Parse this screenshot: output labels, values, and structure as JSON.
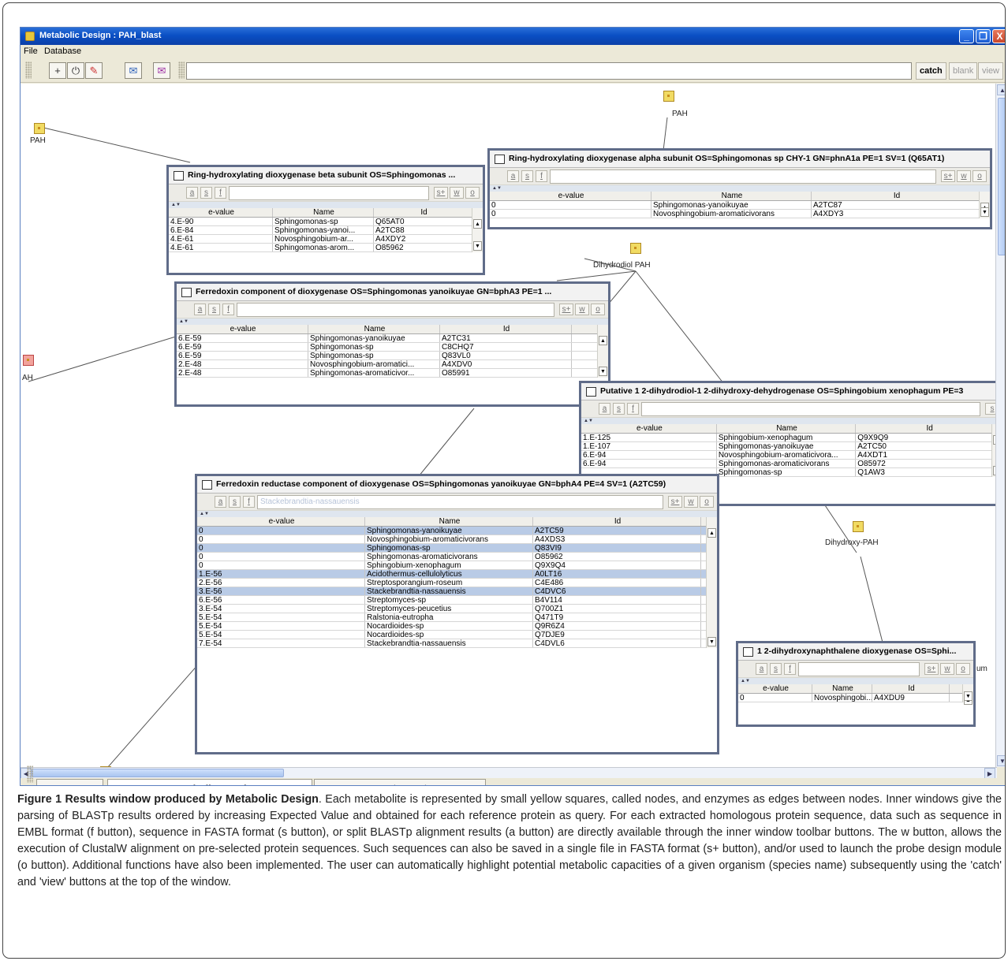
{
  "window": {
    "title": "Metabolic Design  :  PAH_blast",
    "menu": [
      "File",
      "Database"
    ],
    "controls": [
      "_",
      "❐",
      "X"
    ]
  },
  "toolbar": {
    "buttons": [
      "+",
      "⏻",
      "✎",
      "✉",
      "✉"
    ],
    "right": [
      "catch",
      "blank",
      "view"
    ]
  },
  "nodes": [
    {
      "label": "PAH"
    },
    {
      "label": "PAH"
    },
    {
      "label": "AH"
    },
    {
      "label": "Dihydrodiol PAH"
    },
    {
      "label": "Dihydroxy-PAH"
    },
    {
      "label": ""
    }
  ],
  "inner_windows": [
    {
      "title": "Ring-hydroxylating dioxygenase beta subunit OS=Sphingomonas ...",
      "toolbar": [
        "a",
        "s",
        "f"
      ],
      "toolbar_right": [
        "s+",
        "w",
        "o"
      ],
      "search": "",
      "columns": [
        "e-value",
        "Name",
        "Id"
      ],
      "rows": [
        [
          "4.E-90",
          "Sphingomonas-sp",
          "Q65AT0"
        ],
        [
          "6.E-84",
          "Sphingomonas-yanoi...",
          "A2TC88"
        ],
        [
          "4.E-61",
          "Novosphingobium-ar...",
          "A4XDY2"
        ],
        [
          "4.E-61",
          "Sphingomonas-arom...",
          "O85962"
        ]
      ]
    },
    {
      "title": "Ring-hydroxylating dioxygenase alpha subunit OS=Sphingomonas sp CHY-1 GN=phnA1a PE=1 SV=1 (Q65AT1)",
      "toolbar": [
        "a",
        "s",
        "f"
      ],
      "toolbar_right": [
        "s+",
        "w",
        "o"
      ],
      "search": "",
      "columns": [
        "e-value",
        "Name",
        "Id"
      ],
      "rows": [
        [
          "0",
          "Sphingomonas-yanoikuyae",
          "A2TC87"
        ],
        [
          "0",
          "Novosphingobium-aromaticivorans",
          "A4XDY3"
        ]
      ]
    },
    {
      "title": "Ferredoxin component of dioxygenase OS=Sphingomonas yanoikuyae GN=bphA3 PE=1 ...",
      "toolbar": [
        "a",
        "s",
        "f"
      ],
      "toolbar_right": [
        "s+",
        "w",
        "o"
      ],
      "search": "",
      "columns": [
        "e-value",
        "Name",
        "Id"
      ],
      "rows": [
        [
          "6.E-59",
          "Sphingomonas-yanoikuyae",
          "A2TC31"
        ],
        [
          "6.E-59",
          "Sphingomonas-sp",
          "C8CHQ7"
        ],
        [
          "6.E-59",
          "Sphingomonas-sp",
          "Q83VL0"
        ],
        [
          "2.E-48",
          "Novosphingobium-aromatici...",
          "A4XDV0"
        ],
        [
          "2.E-48",
          "Sphingomonas-aromaticivor...",
          "O85991"
        ]
      ]
    },
    {
      "title": "Putative 1 2-dihydrodiol-1 2-dihydroxy-dehydrogenase OS=Sphingobium xenophagum PE=3",
      "toolbar": [
        "a",
        "s",
        "f"
      ],
      "toolbar_right": [
        "s"
      ],
      "search": "",
      "columns": [
        "e-value",
        "Name",
        "Id"
      ],
      "rows": [
        [
          "1.E-125",
          "Sphingobium-xenophagum",
          "Q9X9Q9"
        ],
        [
          "1.E-107",
          "Sphingomonas-yanoikuyae",
          "A2TC50"
        ],
        [
          "6.E-94",
          "Novosphingobium-aromaticivora...",
          "A4XDT1"
        ],
        [
          "6.E-94",
          "Sphingomonas-aromaticivorans",
          "O85972"
        ],
        [
          "",
          "Sphingomonas-sp",
          "Q1AW3"
        ]
      ]
    },
    {
      "title": "Ferredoxin reductase component of dioxygenase OS=Sphingomonas yanoikuyae GN=bphA4 PE=4 SV=1 (A2TC59)",
      "toolbar": [
        "a",
        "s",
        "f"
      ],
      "toolbar_right": [
        "s+",
        "w",
        "o"
      ],
      "search": "Stackebrandtia-nassauensis",
      "columns": [
        "e-value",
        "Name",
        "Id"
      ],
      "rows": [
        [
          "0",
          "Sphingomonas-yanoikuyae",
          "A2TC59"
        ],
        [
          "0",
          "Novosphingobium-aromaticivorans",
          "A4XDS3"
        ],
        [
          "0",
          "Sphingomonas-sp",
          "Q83VI9"
        ],
        [
          "0",
          "Sphingomonas-aromaticivorans",
          "O85962"
        ],
        [
          "0",
          "Sphingobium-xenophagum",
          "Q9X9Q4"
        ],
        [
          "1.E-56",
          "Acidothermus-cellulolyticus",
          "A0LT16"
        ],
        [
          "2.E-56",
          "Streptosporangium-roseum",
          "C4E486"
        ],
        [
          "3.E-56",
          "Stackebrandtia-nassauensis",
          "C4DVC6"
        ],
        [
          "6.E-56",
          "Streptomyces-sp",
          "B4V114"
        ],
        [
          "3.E-54",
          "Streptomyces-peucetius",
          "Q700Z1"
        ],
        [
          "5.E-54",
          "Ralstonia-eutropha",
          "Q471T9"
        ],
        [
          "5.E-54",
          "Nocardioides-sp",
          "Q9R6Z4"
        ],
        [
          "5.E-54",
          "Nocardioides-sp",
          "Q7DJE9"
        ],
        [
          "7.E-54",
          "Stackebrandtia-nassauensis",
          "C4DVL6"
        ]
      ],
      "selected": [
        0,
        2,
        5,
        7
      ]
    },
    {
      "title": "1 2-dihydroxynaphthalene dioxygenase OS=Sphi...",
      "toolbar": [
        "a",
        "s",
        "f"
      ],
      "toolbar_right": [
        "s+",
        "w",
        "o"
      ],
      "search": "",
      "columns": [
        "e-value",
        "Name",
        "Id"
      ],
      "rows": [
        [
          "0",
          "Novosphingobi...",
          "A4XDU9"
        ]
      ]
    }
  ],
  "side_text": "um",
  "tabs": [
    "- BLAST -",
    "- Metabolic Graph -",
    "- Result Graph -"
  ],
  "caption": {
    "lead": "Figure 1 Results window produced by Metabolic Design",
    "body": ". Each metabolite is represented by small yellow squares, called nodes, and enzymes as edges between nodes. Inner windows give the parsing of BLASTp results ordered by increasing Expected Value and obtained for each reference protein as query. For each extracted homologous protein sequence, data such as sequence in EMBL format (f button), sequence in FASTA format (s button), or split BLASTp alignment results (a button) are directly available through the inner window toolbar buttons. The w button, allows the execution of ClustalW alignment on pre-selected protein sequences. Such sequences can also be saved in a single file in FASTA format (s+ button), and/or used to launch the probe design module (o button). Additional functions have also been implemented. The user can automatically highlight potential metabolic capacities of a given organism (species name) subsequently using the 'catch' and 'view' buttons at the top of the window."
  }
}
